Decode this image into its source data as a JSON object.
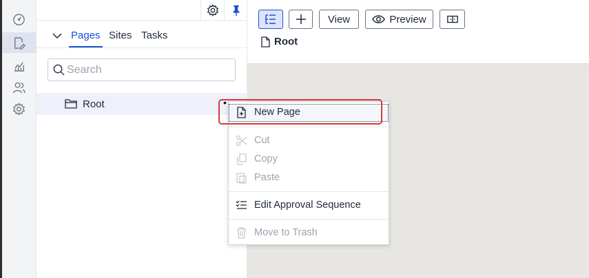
{
  "rail": {
    "items": [
      {
        "name": "dashboard-icon",
        "active": false
      },
      {
        "name": "edit-pages-icon",
        "active": true
      },
      {
        "name": "analytics-icon",
        "active": false
      },
      {
        "name": "users-icon",
        "active": false
      },
      {
        "name": "settings-icon",
        "active": false
      }
    ]
  },
  "panel": {
    "tabs": [
      {
        "label": "Pages",
        "active": true
      },
      {
        "label": "Sites",
        "active": false
      },
      {
        "label": "Tasks",
        "active": false
      }
    ],
    "search": {
      "placeholder": "Search"
    },
    "tree": {
      "root_label": "Root"
    }
  },
  "toolbar": {
    "view_label": "View",
    "preview_label": "Preview"
  },
  "breadcrumb": {
    "current": "Root"
  },
  "context_menu": {
    "new_page": "New Page",
    "cut": "Cut",
    "copy": "Copy",
    "paste": "Paste",
    "edit_approval": "Edit Approval Sequence",
    "move_to_trash": "Move to Trash"
  },
  "colors": {
    "accent": "#1d4ed8",
    "highlight_border": "#d63a3a",
    "disabled_text": "#9ca3af"
  }
}
